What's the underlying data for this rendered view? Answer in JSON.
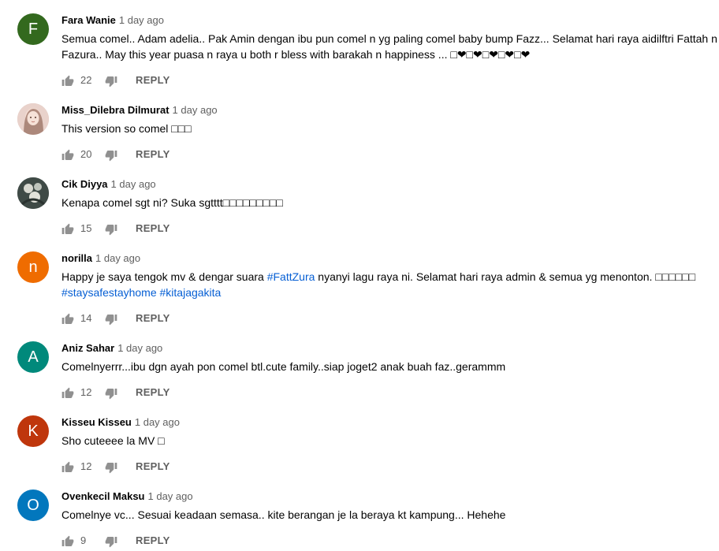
{
  "comments": [
    {
      "author": "Fara Wanie",
      "time": "1 day ago",
      "avatar_letter": "F",
      "avatar_color": "#33691e",
      "text": "Semua comel.. Adam adelia.. Pak Amin dengan ibu pun comel n yg paling comel baby bump Fazz... Selamat hari raya aidilftri Fattah n Fazura.. May this year puasa n raya u both r bless with barakah n happiness ... □❤□❤□❤□❤□❤",
      "likes": "22",
      "reply_label": "REPLY"
    },
    {
      "author": "Miss_Dilebra Dilmurat",
      "time": "1 day ago",
      "avatar_letter": "",
      "avatar_color": "#d9b6ad",
      "text": "This version so comel □□□",
      "likes": "20",
      "reply_label": "REPLY"
    },
    {
      "author": "Cik Diyya",
      "time": "1 day ago",
      "avatar_letter": "",
      "avatar_color": "#4e5a55",
      "text": "Kenapa comel sgt ni? Suka sgtttt□□□□□□□□□",
      "likes": "15",
      "reply_label": "REPLY"
    },
    {
      "author": "norilla",
      "time": "1 day ago",
      "avatar_letter": "n",
      "avatar_color": "#ef6c00",
      "text_before": "Happy je saya tengok mv & dengar suara ",
      "tag1": "#FattZura",
      "text_after": " nyanyi lagu raya ni. Selamat hari raya admin & semua yg menonton. □□□□□□ ",
      "tag2": "#staysafestayhome",
      "tag3": "#kitajagakita",
      "likes": "14",
      "reply_label": "REPLY"
    },
    {
      "author": "Aniz Sahar",
      "time": "1 day ago",
      "avatar_letter": "A",
      "avatar_color": "#00897b",
      "text": "Comelnyerrr...ibu dgn ayah pon comel btl.cute family..siap joget2 anak buah faz..gerammm",
      "likes": "12",
      "reply_label": "REPLY"
    },
    {
      "author": "Kisseu Kisseu",
      "time": "1 day ago",
      "avatar_letter": "K",
      "avatar_color": "#bf360c",
      "text": "Sho cuteeee la MV □",
      "likes": "12",
      "reply_label": "REPLY"
    },
    {
      "author": "Ovenkecil Maksu",
      "time": "1 day ago",
      "avatar_letter": "O",
      "avatar_color": "#0277bd",
      "text": "Comelnye vc...  Sesuai keadaan semasa..  kite berangan je la beraya kt kampung... Hehehe",
      "likes": "9",
      "reply_label": "REPLY"
    }
  ]
}
